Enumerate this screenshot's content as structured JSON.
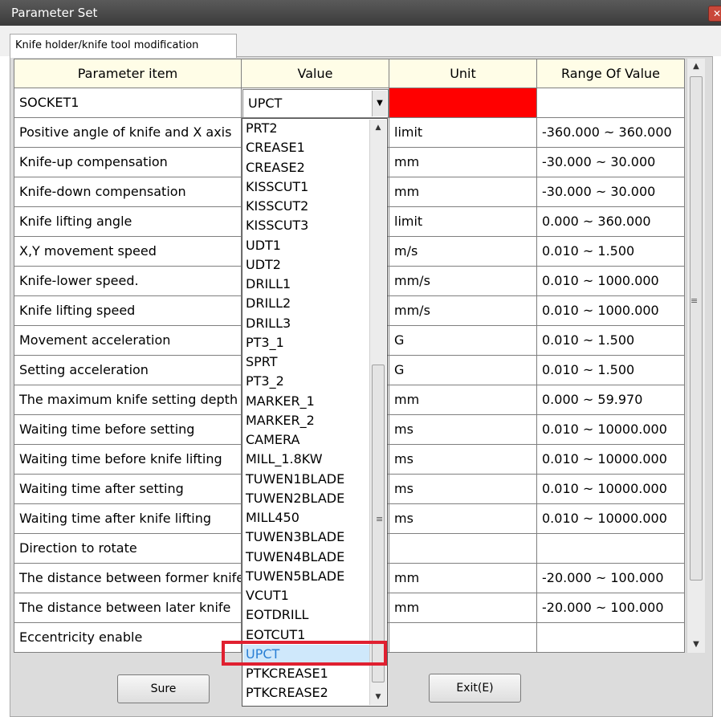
{
  "window": {
    "title": "Parameter Set",
    "close_label": "✕"
  },
  "tab": {
    "label": "Knife holder/knife tool modification"
  },
  "table": {
    "headers": [
      "Parameter item",
      "Value",
      "Unit",
      "Range Of Value"
    ],
    "rows": [
      [
        "SOCKET1",
        "",
        "",
        ""
      ],
      [
        "Positive angle of knife and X axis",
        "",
        "limit",
        "-360.000 ~ 360.000"
      ],
      [
        "Knife-up compensation",
        "",
        "mm",
        "-30.000 ~ 30.000"
      ],
      [
        "Knife-down compensation",
        "",
        "mm",
        "-30.000 ~ 30.000"
      ],
      [
        "Knife lifting angle",
        "",
        "limit",
        "0.000 ~ 360.000"
      ],
      [
        "X,Y movement speed",
        "",
        "m/s",
        "0.010 ~ 1.500"
      ],
      [
        "Knife-lower speed.",
        "",
        "mm/s",
        "0.010 ~ 1000.000"
      ],
      [
        "Knife lifting speed",
        "",
        "mm/s",
        "0.010 ~ 1000.000"
      ],
      [
        "Movement acceleration",
        "",
        "G",
        "0.010 ~ 1.500"
      ],
      [
        "Setting acceleration",
        "",
        "G",
        "0.010 ~ 1.500"
      ],
      [
        "The maximum knife setting depth",
        "",
        "mm",
        "0.000 ~ 59.970"
      ],
      [
        "Waiting time before setting",
        "",
        "ms",
        "0.010 ~ 10000.000"
      ],
      [
        "Waiting time before knife lifting",
        "",
        "ms",
        "0.010 ~ 10000.000"
      ],
      [
        "Waiting time after setting",
        "",
        "ms",
        "0.010 ~ 10000.000"
      ],
      [
        "Waiting time after knife lifting",
        "",
        "ms",
        "0.010 ~ 10000.000"
      ],
      [
        "Direction to rotate",
        "",
        "",
        ""
      ],
      [
        "The distance between former knife",
        "",
        "mm",
        "-20.000 ~ 100.000"
      ],
      [
        "The distance between later knife",
        "",
        "mm",
        "-20.000 ~ 100.000"
      ],
      [
        "Eccentricity enable",
        "",
        "",
        ""
      ]
    ],
    "unit_color_row0": "#ff0000"
  },
  "combo": {
    "value": "UPCT"
  },
  "dropdown": {
    "items": [
      "PRT2",
      "CREASE1",
      "CREASE2",
      "KISSCUT1",
      "KISSCUT2",
      "KISSCUT3",
      "UDT1",
      "UDT2",
      "DRILL1",
      "DRILL2",
      "DRILL3",
      "PT3_1",
      "SPRT",
      "PT3_2",
      "MARKER_1",
      "MARKER_2",
      "CAMERA",
      "MILL_1.8KW",
      "TUWEN1BLADE",
      "TUWEN2BLADE",
      "MILL450",
      "TUWEN3BLADE",
      "TUWEN4BLADE",
      "TUWEN5BLADE",
      "VCUT1",
      "EOTDRILL",
      "EOTCUT1",
      "UPCT",
      "PTKCREASE1",
      "PTKCREASE2"
    ],
    "selected": "UPCT"
  },
  "buttons": {
    "sure": "Sure",
    "exit": "Exit(E)"
  },
  "icons": {
    "scroll_up": "▲",
    "scroll_down": "▼",
    "combo_arrow": "▼",
    "grip": "≡"
  },
  "accent": {
    "highlight": "#e02030",
    "selection_bg": "#cfe8fb",
    "selection_text": "#2a7fd4"
  }
}
